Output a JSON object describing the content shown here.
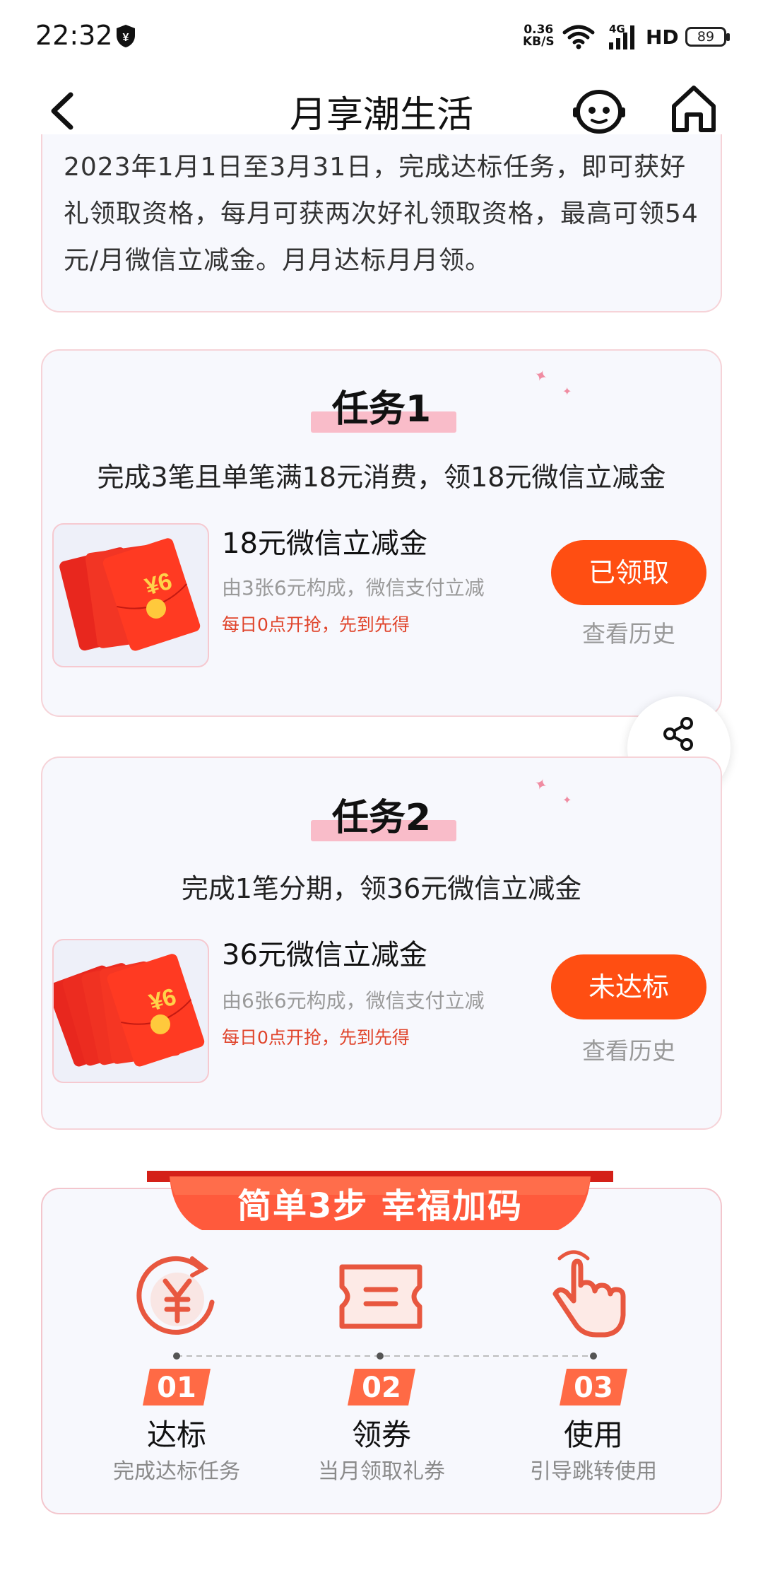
{
  "status_bar": {
    "time": "22:32",
    "net_speed_value": "0.36",
    "net_speed_unit": "KB/S",
    "signal_label": "4G",
    "hd_label": "HD",
    "battery": "89"
  },
  "nav": {
    "title": "月享潮生活"
  },
  "intro": {
    "text": "2023年1月1日至3月31日，完成达标任务，即可获好礼领取资格，每月可获两次好礼领取资格，最高可领54元/月微信立减金。月月达标月月领。"
  },
  "tasks": [
    {
      "title": "任务1",
      "desc": "完成3笔且单笔满18元消费，领18元微信立减金",
      "coupon_name": "18元微信立减金",
      "coupon_sub": "由3张6元构成，微信支付立减",
      "coupon_note": "每日0点开抢，先到先得",
      "envelope_amount": "¥6",
      "button_label": "已领取",
      "history_label": "查看历史"
    },
    {
      "title": "任务2",
      "desc": "完成1笔分期，领36元微信立减金",
      "coupon_name": "36元微信立减金",
      "coupon_sub": "由6张6元构成，微信支付立减",
      "coupon_note": "每日0点开抢，先到先得",
      "envelope_amount": "¥6",
      "button_label": "未达标",
      "history_label": "查看历史"
    }
  ],
  "share": {
    "label": "分享"
  },
  "steps": {
    "banner": "简单3步 幸福加码",
    "items": [
      {
        "num": "01",
        "title": "达标",
        "desc": "完成达标任务"
      },
      {
        "num": "02",
        "title": "领券",
        "desc": "当月领取礼券"
      },
      {
        "num": "03",
        "title": "使用",
        "desc": "引导跳转使用"
      }
    ]
  },
  "colors": {
    "accent": "#ff4e12",
    "card_bg": "#f7f8fd",
    "card_border": "#f6d3d8",
    "note_red": "#e0442b"
  }
}
